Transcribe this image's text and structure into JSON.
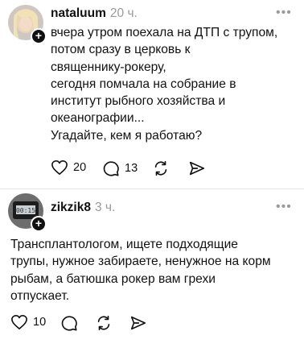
{
  "posts": [
    {
      "username": "nataluum",
      "time": "20 ч.",
      "text": "вчера утром поехала на ДТП с трупом,\nпотом сразу в церковь к\nсвященнику-рокеру,\nсегодня помчала на собрание в\nинститут рыбного хозяйства и\nокеанографии...\nУгадайте, кем я работаю?",
      "likes": "20",
      "replies": "13"
    },
    {
      "username": "zikzik8",
      "time": "3 ч.",
      "text": "Трансплантологом, ищете подходящие\nтрупы, нужное забираете, ненужное на корм\nрыбам, а батюшка рокер вам грехи\nотпускает.",
      "likes": "10",
      "replies": ""
    }
  ],
  "ui": {
    "more_label": "•••",
    "follow_label": "+"
  },
  "icons": {
    "like": "heart-icon",
    "reply": "comment-icon",
    "repost": "repost-icon",
    "share": "send-icon",
    "more": "more-icon",
    "follow": "plus-icon"
  },
  "colors": {
    "text": "#111111",
    "muted": "#9a9a9a",
    "divider": "#e4e4e4"
  }
}
